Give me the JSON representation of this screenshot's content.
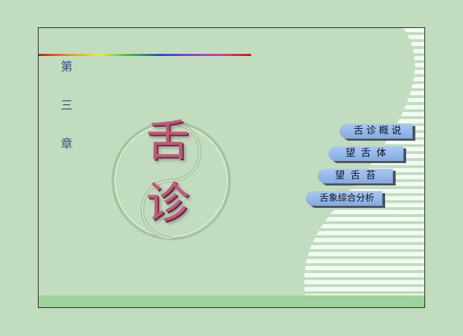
{
  "chapter": {
    "chars": [
      "第",
      "三",
      "章"
    ]
  },
  "title": {
    "chars": [
      "舌",
      "诊"
    ]
  },
  "menu": {
    "items": [
      {
        "label": "舌诊概说"
      },
      {
        "label": "望舌体"
      },
      {
        "label": "望舌苔"
      },
      {
        "label": "舌象综合分析"
      }
    ]
  },
  "colors": {
    "background": "#c1dcbf",
    "stripe": "#f2fbf2",
    "bottom_bar": "#9fd29a",
    "button": "#94b8ea",
    "title_char": "#c05a7a",
    "chapter_text": "#3a4a8a"
  }
}
